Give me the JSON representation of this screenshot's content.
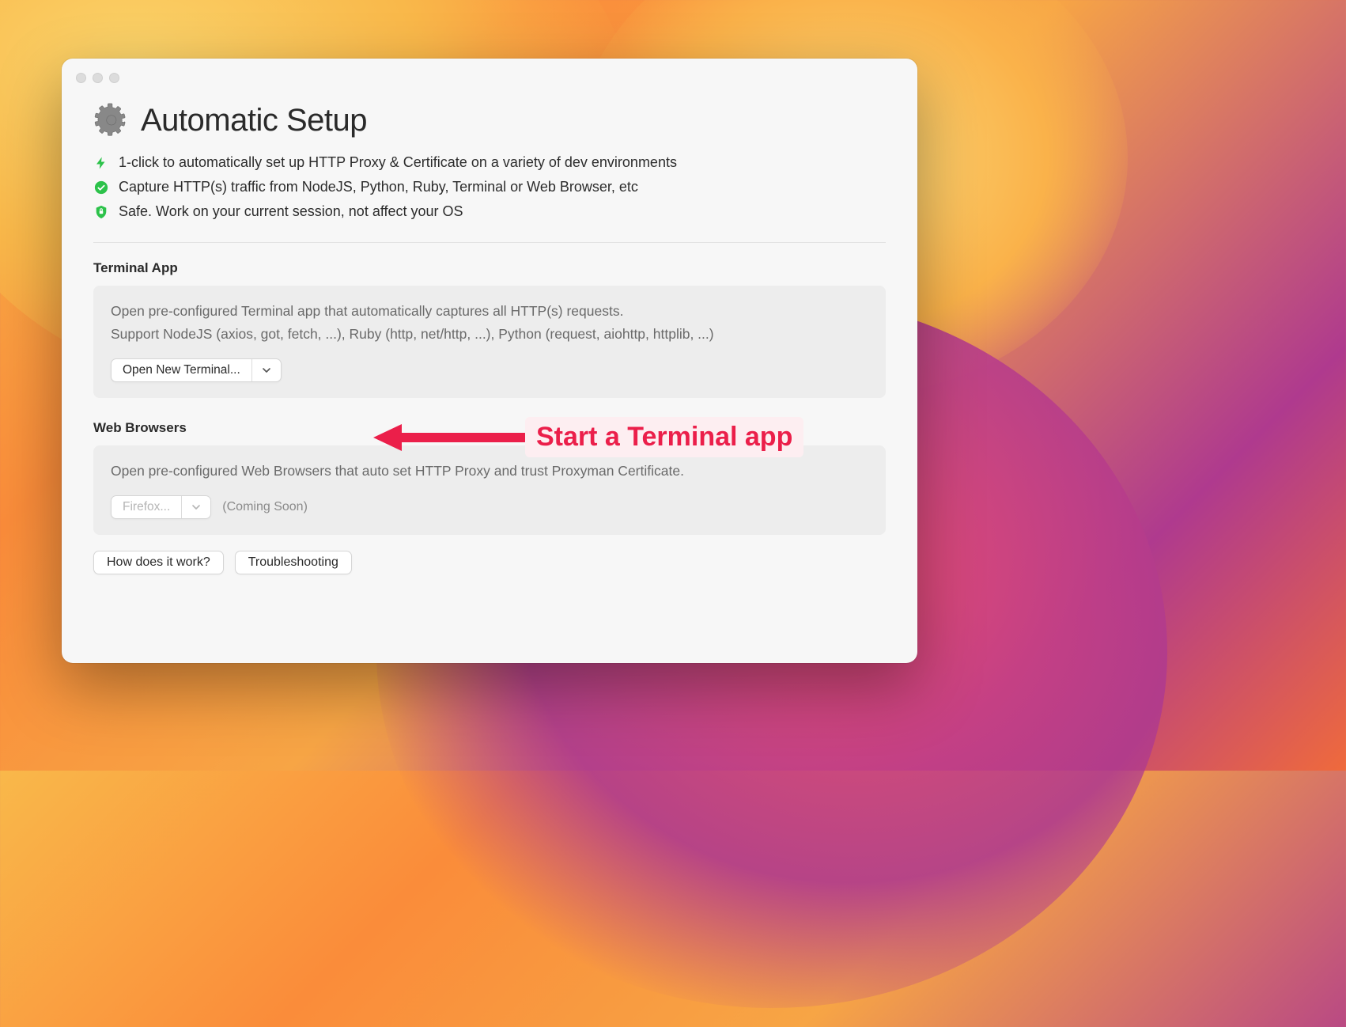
{
  "title": "Automatic Setup",
  "features": [
    {
      "icon": "bolt-icon",
      "text": "1-click to automatically set up HTTP Proxy & Certificate on a variety of dev environments"
    },
    {
      "icon": "checkmark-circle-icon",
      "text": "Capture HTTP(s) traffic from NodeJS, Python, Ruby, Terminal or Web Browser, etc"
    },
    {
      "icon": "shield-lock-icon",
      "text": "Safe. Work on your current session, not affect your OS"
    }
  ],
  "terminal_section": {
    "label": "Terminal App",
    "desc_line1": "Open pre-configured Terminal app that automatically captures all HTTP(s) requests.",
    "desc_line2": "Support NodeJS (axios, got, fetch, ...), Ruby (http, net/http, ...), Python (request, aiohttp, httplib, ...)",
    "button_label": "Open New Terminal..."
  },
  "browser_section": {
    "label": "Web Browsers",
    "desc": "Open pre-configured Web Browsers that auto set HTTP Proxy and trust Proxyman Certificate.",
    "button_label": "Firefox...",
    "coming_soon": "(Coming Soon)"
  },
  "footer": {
    "how": "How does it work?",
    "trouble": "Troubleshooting"
  },
  "annotation": {
    "text": "Start a Terminal app",
    "color": "#eb1f4a"
  }
}
